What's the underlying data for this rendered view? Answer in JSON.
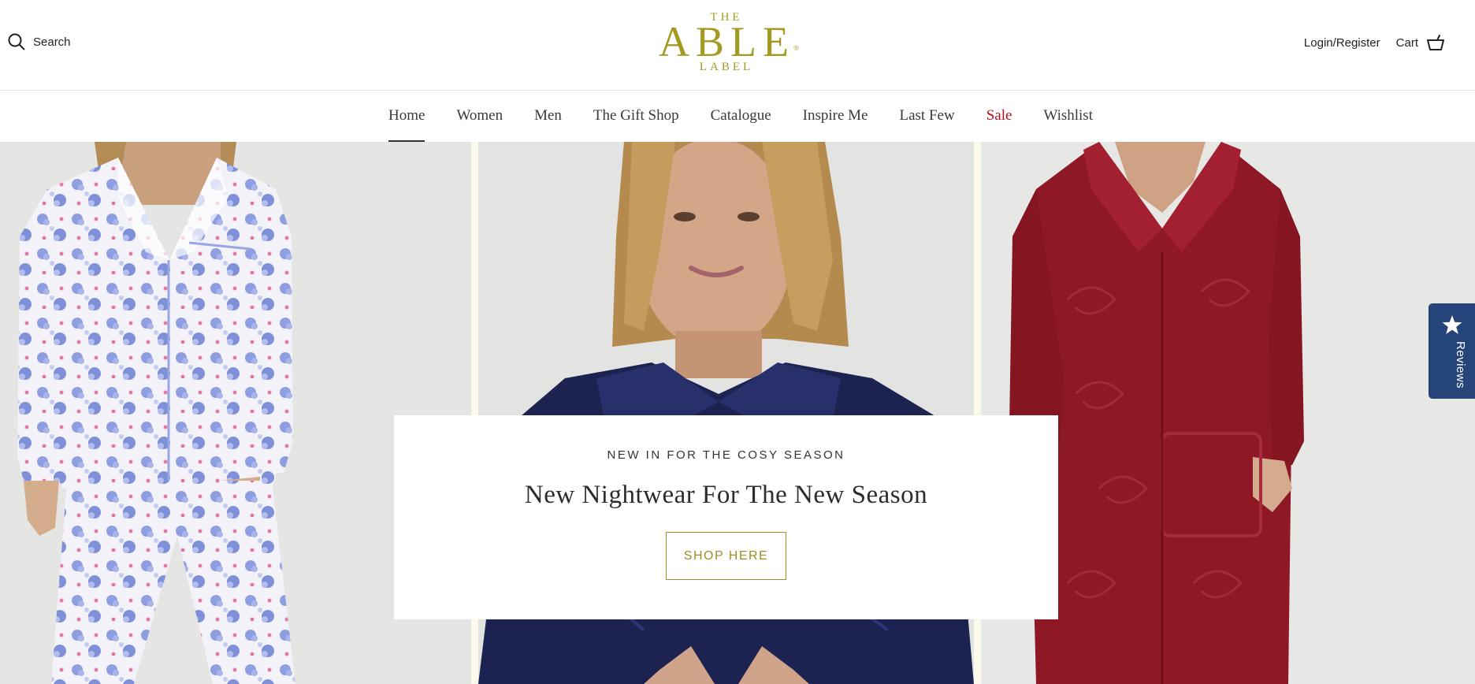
{
  "header": {
    "search_label": "Search",
    "logo": {
      "top": "THE",
      "main": "ABLE",
      "mark": "®",
      "bottom": "LABEL"
    },
    "login_label": "Login/Register",
    "cart_label": "Cart"
  },
  "nav": {
    "items": [
      {
        "label": "Home"
      },
      {
        "label": "Women"
      },
      {
        "label": "Men"
      },
      {
        "label": "The Gift Shop"
      },
      {
        "label": "Catalogue"
      },
      {
        "label": "Inspire Me"
      },
      {
        "label": "Last Few"
      },
      {
        "label": "Sale"
      },
      {
        "label": "Wishlist"
      }
    ],
    "active": "Home"
  },
  "hero": {
    "eyebrow": "NEW IN FOR THE COSY SEASON",
    "headline": "New Nightwear For The New Season",
    "cta_label": "SHOP HERE"
  },
  "reviews_tab": {
    "label": "Reviews"
  },
  "colors": {
    "brand_gold": "#a39a22",
    "sale_red": "#b3121d",
    "reviews_blue": "#24447a",
    "robe_navy": "#1c2350",
    "robe_red": "#8f1826"
  }
}
